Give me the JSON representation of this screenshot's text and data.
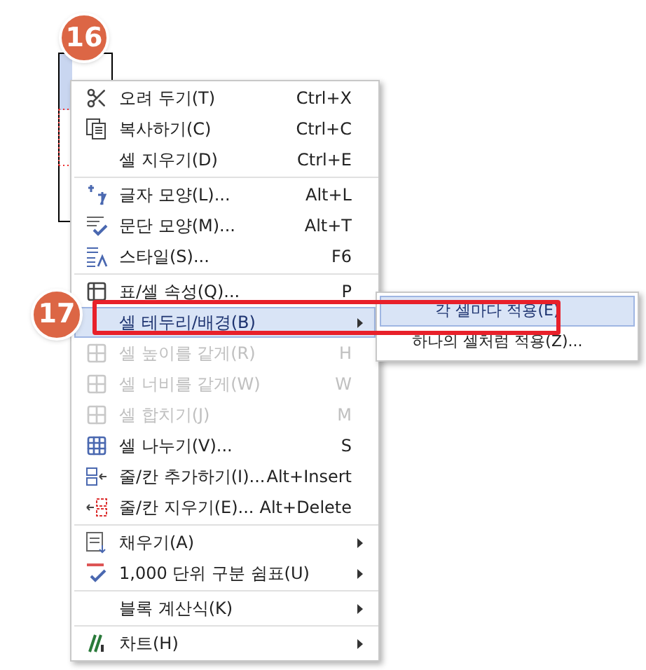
{
  "badges": [
    {
      "text": "16"
    },
    {
      "text": "17"
    }
  ],
  "menu": {
    "items": [
      {
        "kind": "item",
        "label": "오려 두기(T)",
        "shortcut": "Ctrl+X",
        "disabled": false,
        "selected": false,
        "submenu": false
      },
      {
        "kind": "item",
        "label": "복사하기(C)",
        "shortcut": "Ctrl+C",
        "disabled": false,
        "selected": false,
        "submenu": false
      },
      {
        "kind": "item",
        "label": "셀 지우기(D)",
        "shortcut": "Ctrl+E",
        "disabled": false,
        "selected": false,
        "submenu": false
      },
      {
        "kind": "separator"
      },
      {
        "kind": "item",
        "label": "글자 모양(L)...",
        "shortcut": "Alt+L",
        "disabled": false,
        "selected": false,
        "submenu": false
      },
      {
        "kind": "item",
        "label": "문단 모양(M)...",
        "shortcut": "Alt+T",
        "disabled": false,
        "selected": false,
        "submenu": false
      },
      {
        "kind": "item",
        "label": "스타일(S)...",
        "shortcut": "F6",
        "disabled": false,
        "selected": false,
        "submenu": false
      },
      {
        "kind": "separator"
      },
      {
        "kind": "item",
        "label": "표/셀 속성(Q)...",
        "shortcut": "P",
        "disabled": false,
        "selected": false,
        "submenu": false
      },
      {
        "kind": "item",
        "label": "셀 테두리/배경(B)",
        "disabled": false,
        "selected": true,
        "submenu": true
      },
      {
        "kind": "item",
        "label": "셀 높이를 같게(R)",
        "shortcut": "H",
        "disabled": true,
        "selected": false,
        "submenu": false
      },
      {
        "kind": "item",
        "label": "셀 너비를 같게(W)",
        "shortcut": "W",
        "disabled": true,
        "selected": false,
        "submenu": false
      },
      {
        "kind": "item",
        "label": "셀 합치기(J)",
        "shortcut": "M",
        "disabled": true,
        "selected": false,
        "submenu": false
      },
      {
        "kind": "item",
        "label": "셀 나누기(V)...",
        "shortcut": "S",
        "disabled": false,
        "selected": false,
        "submenu": false
      },
      {
        "kind": "item",
        "label": "줄/칸 추가하기(I)...",
        "shortcut": "Alt+Insert",
        "disabled": false,
        "selected": false,
        "submenu": false
      },
      {
        "kind": "item",
        "label": "줄/칸 지우기(E)...",
        "shortcut": "Alt+Delete",
        "disabled": false,
        "selected": false,
        "submenu": false
      },
      {
        "kind": "separator"
      },
      {
        "kind": "item",
        "label": "채우기(A)",
        "disabled": false,
        "selected": false,
        "submenu": true
      },
      {
        "kind": "item",
        "label": "1,000 단위 구분 쉼표(U)",
        "disabled": false,
        "selected": false,
        "submenu": true
      },
      {
        "kind": "separator"
      },
      {
        "kind": "item",
        "label": "블록 계산식(K)",
        "disabled": false,
        "selected": false,
        "submenu": true
      },
      {
        "kind": "separator"
      },
      {
        "kind": "item",
        "label": "차트(H)",
        "disabled": false,
        "selected": false,
        "submenu": true
      }
    ]
  },
  "submenu": {
    "items": [
      {
        "label": "각 셀마다 적용(E)",
        "selected": true
      },
      {
        "label": "하나의 셀처럼 적용(Z)...",
        "selected": false
      }
    ]
  }
}
